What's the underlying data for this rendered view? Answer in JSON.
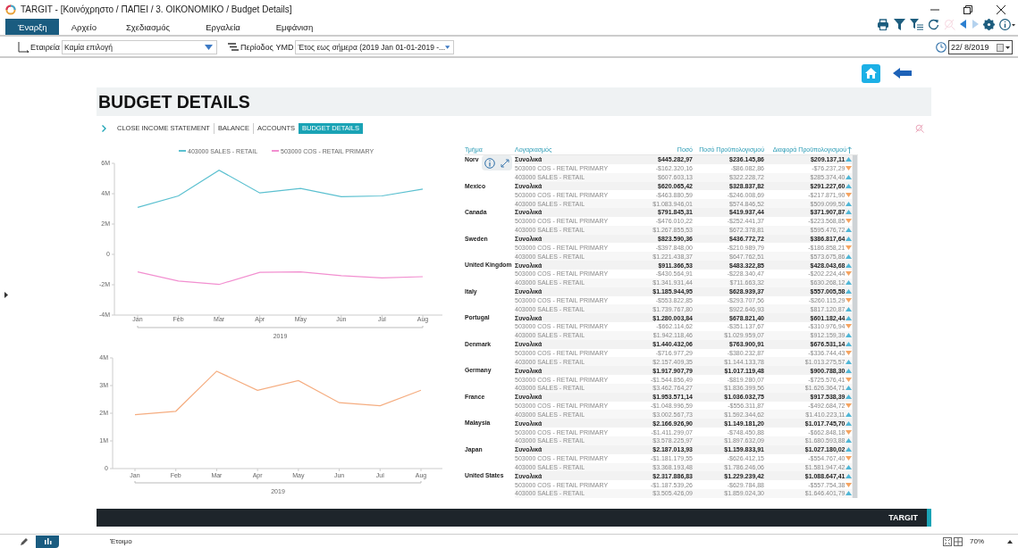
{
  "window": {
    "title": "TARGIT - [Κοινόχρηστο / ΠΑΠΕΙ / 3. ΟΙΚΟΝΟΜΙΚΟ / Budget Details]"
  },
  "menu_tabs": [
    {
      "label": "Έναρξη",
      "selected": true
    },
    {
      "label": "Αρχείο",
      "selected": false
    },
    {
      "label": "Σχεδιασμός",
      "selected": false
    },
    {
      "label": "Εργαλεία",
      "selected": false
    },
    {
      "label": "Εμφάνιση",
      "selected": false
    }
  ],
  "toolbar": [
    {
      "kind": "print",
      "disabled": false
    },
    {
      "kind": "filter",
      "disabled": false
    },
    {
      "kind": "filter-list",
      "disabled": false
    },
    {
      "kind": "refresh",
      "disabled": false
    },
    {
      "kind": "clear",
      "disabled": true
    },
    {
      "kind": "back",
      "disabled": false
    },
    {
      "kind": "forward",
      "disabled": true
    },
    {
      "kind": "settings",
      "disabled": false
    },
    {
      "kind": "info",
      "disabled": false
    }
  ],
  "filters": [
    {
      "kind": "hierarchy",
      "label": "Εταιρεία",
      "value": "Καμία επιλογή"
    },
    {
      "kind": "list",
      "label": "Περίοδος YMD",
      "value": "Έτος εως σήμερα (2019 Jan 01-01-2019 -..."
    }
  ],
  "date": {
    "value": "22/  8/2019"
  },
  "dashboard": {
    "title": "BUDGET DETAILS",
    "nav": [
      {
        "label": "CLOSE INCOME STATEMENT",
        "selected": false
      },
      {
        "label": "BALANCE",
        "selected": false
      },
      {
        "label": "ACCOUNTS",
        "selected": false
      },
      {
        "label": "BUDGET DETAILS",
        "selected": true
      }
    ],
    "charts": [
      {
        "chart_data": {
          "type": "line",
          "legend": "top",
          "xlabel": "2019",
          "categories": [
            "Jan",
            "Feb",
            "Mar",
            "Apr",
            "May",
            "Jun",
            "Jul",
            "Aug"
          ],
          "ylim": [
            -4000000,
            6000000
          ],
          "yticks": [
            {
              "value": 6000000,
              "label": "6M"
            },
            {
              "value": 4000000,
              "label": "4M"
            },
            {
              "value": 2000000,
              "label": "2M"
            },
            {
              "value": 0,
              "label": "0"
            },
            {
              "value": -2000000,
              "label": "-2M"
            },
            {
              "value": -4000000,
              "label": "-4M"
            }
          ],
          "series": [
            {
              "name": "403000 SALES - RETAIL",
              "color": "#5bc0d0",
              "values": [
                3100000,
                3850000,
                5550000,
                4050000,
                4350000,
                3800000,
                3850000,
                4300000
              ]
            },
            {
              "name": "503000 COS - RETAIL PRIMARY",
              "color": "#f28fd0",
              "values": [
                -1150000,
                -1750000,
                -1980000,
                -1180000,
                -1150000,
                -1400000,
                -1550000,
                -1470000
              ]
            }
          ]
        }
      },
      {
        "chart_data": {
          "type": "line",
          "xlabel": "2019",
          "categories": [
            "Jan",
            "Feb",
            "Mar",
            "Apr",
            "May",
            "Jun",
            "Jul",
            "Aug"
          ],
          "ylim": [
            0,
            4000000
          ],
          "yticks": [
            {
              "value": 4000000,
              "label": "4M"
            },
            {
              "value": 3000000,
              "label": "3M"
            },
            {
              "value": 2000000,
              "label": "2M"
            },
            {
              "value": 1000000,
              "label": "1M"
            },
            {
              "value": 0,
              "label": "0"
            }
          ],
          "series": [
            {
              "color": "#f5ad80",
              "values": [
                1950000,
                2070000,
                3520000,
                2830000,
                3180000,
                2380000,
                2270000,
                2830000
              ]
            }
          ]
        }
      }
    ],
    "table": {
      "columns": [
        {
          "label": "Τμήμα",
          "sorted": false
        },
        {
          "label": "Λογαριασμός",
          "sorted": false
        },
        {
          "label": "Ποσό",
          "sorted": false
        },
        {
          "label": "Ποσό Προϋπολογισμού",
          "sorted": false
        },
        {
          "label": "Διαφορά Προϋπολογισμού",
          "sorted": true
        }
      ],
      "groups": [
        {
          "country": "Norv",
          "rows": [
            {
              "kind": "total",
              "account": "Συνολικά",
              "amount": "$445.282,97",
              "budget": "$236.145,86",
              "diff": "$209.137,11",
              "up": true
            },
            {
              "kind": "account",
              "account": "503000 COS - RETAIL PRIMARY",
              "amount": "-$162.320,16",
              "budget": "-$86.082,86",
              "diff": "-$76.237,29",
              "up": false
            },
            {
              "kind": "account",
              "account": "403000 SALES - RETAIL",
              "amount": "$607.603,13",
              "budget": "$322.228,72",
              "diff": "$285.374,40",
              "up": true
            }
          ]
        },
        {
          "country": "Mexico",
          "rows": [
            {
              "kind": "total",
              "account": "Συνολικά",
              "amount": "$620.065,42",
              "budget": "$328.837,82",
              "diff": "$291.227,60",
              "up": true
            },
            {
              "kind": "account",
              "account": "503000 COS - RETAIL PRIMARY",
              "amount": "-$463.880,59",
              "budget": "-$246.008,69",
              "diff": "-$217.871,90",
              "up": false
            },
            {
              "kind": "account",
              "account": "403000 SALES - RETAIL",
              "amount": "$1.083.946,01",
              "budget": "$574.846,52",
              "diff": "$509.099,50",
              "up": true
            }
          ]
        },
        {
          "country": "Canada",
          "rows": [
            {
              "kind": "total",
              "account": "Συνολικά",
              "amount": "$791.845,31",
              "budget": "$419.937,44",
              "diff": "$371.907,87",
              "up": true
            },
            {
              "kind": "account",
              "account": "503000 COS - RETAIL PRIMARY",
              "amount": "-$476.010,22",
              "budget": "-$252.441,37",
              "diff": "-$223.568,85",
              "up": false
            },
            {
              "kind": "account",
              "account": "403000 SALES - RETAIL",
              "amount": "$1.267.855,53",
              "budget": "$672.378,81",
              "diff": "$595.476,72",
              "up": true
            }
          ]
        },
        {
          "country": "Sweden",
          "rows": [
            {
              "kind": "total",
              "account": "Συνολικά",
              "amount": "$823.590,36",
              "budget": "$436.772,72",
              "diff": "$386.817,64",
              "up": true
            },
            {
              "kind": "account",
              "account": "503000 COS - RETAIL PRIMARY",
              "amount": "-$397.848,00",
              "budget": "-$210.989,79",
              "diff": "-$186.858,21",
              "up": false
            },
            {
              "kind": "account",
              "account": "403000 SALES - RETAIL",
              "amount": "$1.221.438,37",
              "budget": "$647.762,51",
              "diff": "$573.675,86",
              "up": true
            }
          ]
        },
        {
          "country": "United Kingdom",
          "rows": [
            {
              "kind": "total",
              "account": "Συνολικά",
              "amount": "$911.366,53",
              "budget": "$483.322,85",
              "diff": "$428.043,68",
              "up": true
            },
            {
              "kind": "account",
              "account": "503000 COS - RETAIL PRIMARY",
              "amount": "-$430.564,91",
              "budget": "-$228.340,47",
              "diff": "-$202.224,44",
              "up": false
            },
            {
              "kind": "account",
              "account": "403000 SALES - RETAIL",
              "amount": "$1.341.931,44",
              "budget": "$711.663,32",
              "diff": "$630.268,12",
              "up": true
            }
          ]
        },
        {
          "country": "Italy",
          "rows": [
            {
              "kind": "total",
              "account": "Συνολικά",
              "amount": "$1.185.944,95",
              "budget": "$628.939,37",
              "diff": "$557.005,58",
              "up": true
            },
            {
              "kind": "account",
              "account": "503000 COS - RETAIL PRIMARY",
              "amount": "-$553.822,85",
              "budget": "-$293.707,56",
              "diff": "-$260.115,29",
              "up": false
            },
            {
              "kind": "account",
              "account": "403000 SALES - RETAIL",
              "amount": "$1.739.767,80",
              "budget": "$922.646,93",
              "diff": "$817.120,87",
              "up": true
            }
          ]
        },
        {
          "country": "Portugal",
          "rows": [
            {
              "kind": "total",
              "account": "Συνολικά",
              "amount": "$1.280.003,84",
              "budget": "$678.821,40",
              "diff": "$601.182,44",
              "up": true
            },
            {
              "kind": "account",
              "account": "503000 COS - RETAIL PRIMARY",
              "amount": "-$662.114,62",
              "budget": "-$351.137,67",
              "diff": "-$310.976,94",
              "up": false
            },
            {
              "kind": "account",
              "account": "403000 SALES - RETAIL",
              "amount": "$1.942.118,46",
              "budget": "$1.029.959,07",
              "diff": "$912.159,39",
              "up": true
            }
          ]
        },
        {
          "country": "Denmark",
          "rows": [
            {
              "kind": "total",
              "account": "Συνολικά",
              "amount": "$1.440.432,06",
              "budget": "$763.900,91",
              "diff": "$676.531,14",
              "up": true
            },
            {
              "kind": "account",
              "account": "503000 COS - RETAIL PRIMARY",
              "amount": "-$716.977,29",
              "budget": "-$380.232,87",
              "diff": "-$336.744,43",
              "up": false
            },
            {
              "kind": "account",
              "account": "403000 SALES - RETAIL",
              "amount": "$2.157.409,35",
              "budget": "$1.144.133,78",
              "diff": "$1.013.275,57",
              "up": true
            }
          ]
        },
        {
          "country": "Germany",
          "rows": [
            {
              "kind": "total",
              "account": "Συνολικά",
              "amount": "$1.917.907,79",
              "budget": "$1.017.119,48",
              "diff": "$900.788,30",
              "up": true
            },
            {
              "kind": "account",
              "account": "503000 COS - RETAIL PRIMARY",
              "amount": "-$1.544.856,49",
              "budget": "-$819.280,07",
              "diff": "-$725.576,41",
              "up": false
            },
            {
              "kind": "account",
              "account": "403000 SALES - RETAIL",
              "amount": "$3.462.764,27",
              "budget": "$1.836.399,56",
              "diff": "$1.626.364,71",
              "up": true
            }
          ]
        },
        {
          "country": "France",
          "rows": [
            {
              "kind": "total",
              "account": "Συνολικά",
              "amount": "$1.953.571,14",
              "budget": "$1.036.032,75",
              "diff": "$917.538,39",
              "up": true
            },
            {
              "kind": "account",
              "account": "503000 COS - RETAIL PRIMARY",
              "amount": "-$1.048.996,59",
              "budget": "-$556.311,87",
              "diff": "-$492.684,72",
              "up": false
            },
            {
              "kind": "account",
              "account": "403000 SALES - RETAIL",
              "amount": "$3.002.567,73",
              "budget": "$1.592.344,62",
              "diff": "$1.410.223,11",
              "up": true
            }
          ]
        },
        {
          "country": "Malaysia",
          "rows": [
            {
              "kind": "total",
              "account": "Συνολικά",
              "amount": "$2.166.926,90",
              "budget": "$1.149.181,20",
              "diff": "$1.017.745,70",
              "up": true
            },
            {
              "kind": "account",
              "account": "503000 COS - RETAIL PRIMARY",
              "amount": "-$1.411.299,07",
              "budget": "-$748.450,88",
              "diff": "-$662.848,18",
              "up": false
            },
            {
              "kind": "account",
              "account": "403000 SALES - RETAIL",
              "amount": "$3.578.225,97",
              "budget": "$1.897.632,09",
              "diff": "$1.680.593,88",
              "up": true
            }
          ]
        },
        {
          "country": "Japan",
          "rows": [
            {
              "kind": "total",
              "account": "Συνολικά",
              "amount": "$2.187.013,93",
              "budget": "$1.159.833,91",
              "diff": "$1.027.180,02",
              "up": true
            },
            {
              "kind": "account",
              "account": "503000 COS - RETAIL PRIMARY",
              "amount": "-$1.181.179,55",
              "budget": "-$626.412,15",
              "diff": "-$554.767,40",
              "up": false
            },
            {
              "kind": "account",
              "account": "403000 SALES - RETAIL",
              "amount": "$3.368.193,48",
              "budget": "$1.786.246,06",
              "diff": "$1.581.947,42",
              "up": true
            }
          ]
        },
        {
          "country": "United States",
          "rows": [
            {
              "kind": "total",
              "account": "Συνολικά",
              "amount": "$2.317.886,83",
              "budget": "$1.229.239,42",
              "diff": "$1.088.647,41",
              "up": true
            },
            {
              "kind": "account",
              "account": "503000 COS - RETAIL PRIMARY",
              "amount": "-$1.187.539,26",
              "budget": "-$629.784,88",
              "diff": "-$557.754,38",
              "up": false
            },
            {
              "kind": "account",
              "account": "403000 SALES - RETAIL",
              "amount": "$3.505.426,09",
              "budget": "$1.859.024,30",
              "diff": "$1.646.401,79",
              "up": true
            }
          ]
        }
      ]
    },
    "footer": {
      "brand": "TARGIT"
    }
  },
  "status_bar": {
    "views": [
      {
        "kind": "edit",
        "selected": false
      },
      {
        "kind": "chart",
        "selected": true
      }
    ],
    "status": "Έτοιμο",
    "zoom": "70%"
  }
}
